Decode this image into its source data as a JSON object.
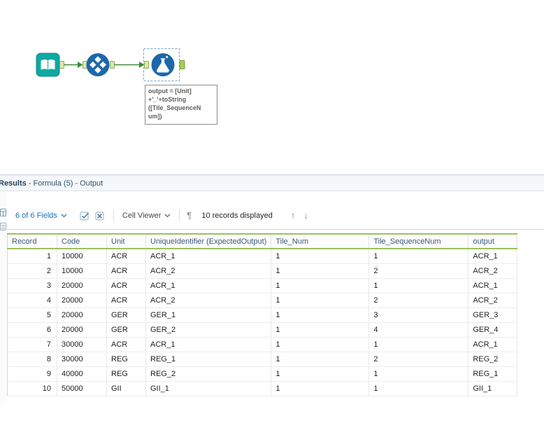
{
  "colors": {
    "accent_blue": "#1a70b8",
    "tool_blue": "#1e67a9",
    "tool_teal": "#0fa8a2",
    "connection_green": "#3d8b37",
    "anchor_green": "#a3ce58",
    "header_line_green": "#9bc25d"
  },
  "canvas": {
    "tools": [
      {
        "id": "input-data"
      },
      {
        "id": "tile"
      },
      {
        "id": "formula"
      }
    ],
    "annotation": "output = [Unit]\n+'_'+toString\n([Tile_SequenceN\num])"
  },
  "results": {
    "title_bold": "Results",
    "title_rest": " - Formula (5) - Output",
    "toolbar": {
      "fields": "6 of 6 Fields",
      "cell_viewer": "Cell Viewer",
      "pilcrow": "¶",
      "records": "10 records displayed",
      "up_arrow": "↑",
      "down_arrow": "↓"
    },
    "table": {
      "columns": [
        "Record",
        "Code",
        "Unit",
        "UniqueIdentifier (ExpectedOutput)",
        "Tile_Num",
        "Tile_SequenceNum",
        "output"
      ],
      "rows": [
        [
          "1",
          "10000",
          "ACR",
          "ACR_1",
          "1",
          "1",
          "ACR_1"
        ],
        [
          "2",
          "10000",
          "ACR",
          "ACR_2",
          "1",
          "2",
          "ACR_2"
        ],
        [
          "3",
          "20000",
          "ACR",
          "ACR_1",
          "1",
          "1",
          "ACR_1"
        ],
        [
          "4",
          "20000",
          "ACR",
          "ACR_2",
          "1",
          "2",
          "ACR_2"
        ],
        [
          "5",
          "20000",
          "GER",
          "GER_1",
          "1",
          "3",
          "GER_3"
        ],
        [
          "6",
          "20000",
          "GER",
          "GER_2",
          "1",
          "4",
          "GER_4"
        ],
        [
          "7",
          "30000",
          "ACR",
          "ACR_1",
          "1",
          "1",
          "ACR_1"
        ],
        [
          "8",
          "30000",
          "REG",
          "REG_1",
          "1",
          "2",
          "REG_2"
        ],
        [
          "9",
          "40000",
          "REG",
          "REG_2",
          "1",
          "1",
          "REG_1"
        ],
        [
          "10",
          "50000",
          "GII",
          "GII_1",
          "1",
          "1",
          "GII_1"
        ]
      ]
    }
  }
}
